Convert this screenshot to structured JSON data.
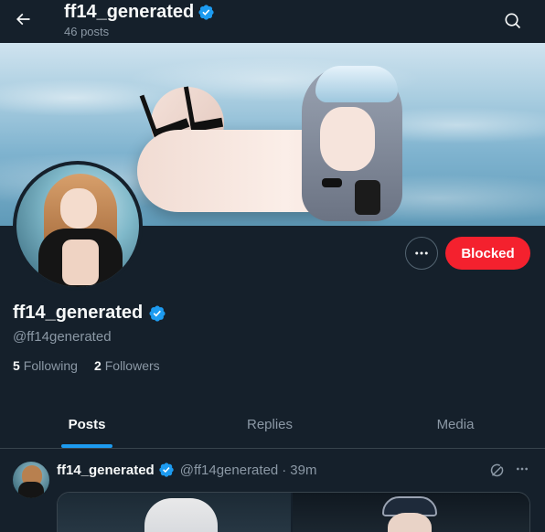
{
  "header": {
    "name": "ff14_generated",
    "posts_count": "46 posts"
  },
  "profile": {
    "display_name": "ff14_generated",
    "handle": "@ff14generated",
    "following_count": "5",
    "following_label": "Following",
    "followers_count": "2",
    "followers_label": "Followers",
    "blocked_label": "Blocked"
  },
  "tabs": [
    {
      "label": "Posts",
      "active": true
    },
    {
      "label": "Replies",
      "active": false
    },
    {
      "label": "Media",
      "active": false
    }
  ],
  "post": {
    "name": "ff14_generated",
    "handle": "@ff14generated",
    "separator": "·",
    "time": "39m"
  },
  "colors": {
    "background": "#15202b",
    "verified": "#1d9bf0",
    "blocked": "#f4212e",
    "tab_underline": "#1d9bf0",
    "muted_text": "#8b98a5"
  },
  "icons": {
    "back": "arrow-left-icon",
    "search": "search-icon",
    "verified": "verified-badge-icon",
    "more": "more-horizontal-icon",
    "grok": "grok-icon"
  }
}
